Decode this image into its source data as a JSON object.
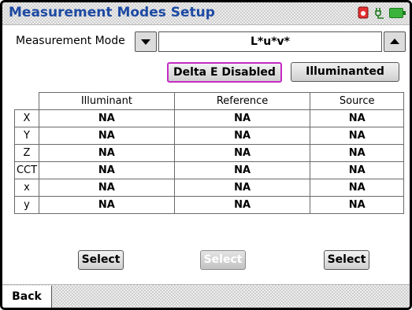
{
  "window": {
    "title": "Measurement Modes Setup"
  },
  "status_icons": [
    "record-icon",
    "plug-icon",
    "battery-icon"
  ],
  "measurement_mode": {
    "label": "Measurement Mode",
    "value": "L*u*v*"
  },
  "buttons": {
    "delta_e": "Delta E Disabled",
    "illuminanted": "Illuminanted",
    "select": "Select",
    "back": "Back"
  },
  "table": {
    "columns": [
      "Illuminant",
      "Reference",
      "Source"
    ],
    "rows": [
      {
        "label": "X",
        "values": [
          "NA",
          "NA",
          "NA"
        ]
      },
      {
        "label": "Y",
        "values": [
          "NA",
          "NA",
          "NA"
        ]
      },
      {
        "label": "Z",
        "values": [
          "NA",
          "NA",
          "NA"
        ]
      },
      {
        "label": "CCT",
        "values": [
          "NA",
          "NA",
          "NA"
        ]
      },
      {
        "label": "x",
        "values": [
          "NA",
          "NA",
          "NA"
        ]
      },
      {
        "label": "y",
        "values": [
          "NA",
          "NA",
          "NA"
        ]
      }
    ]
  },
  "colors": {
    "title": "#1d4aa3",
    "delta_border": "#c42bc4",
    "battery": "#3cb43c",
    "record": "#e23030"
  },
  "select_states": [
    "enabled",
    "disabled",
    "enabled"
  ]
}
